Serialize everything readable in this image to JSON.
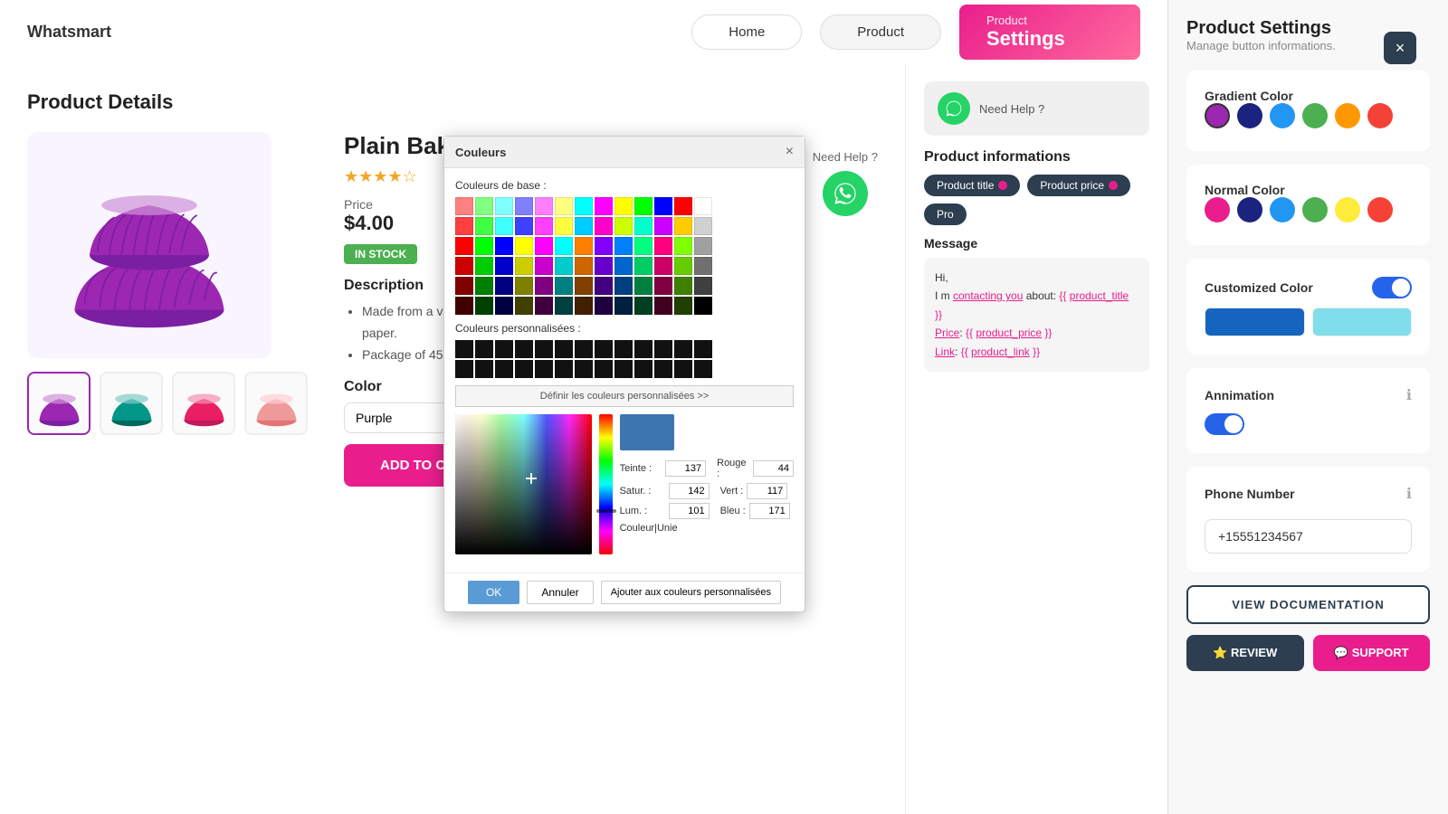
{
  "brand": "Whatsmart",
  "nav": {
    "home": "Home",
    "product": "Product",
    "settings_small": "Product",
    "settings_big": "Settings"
  },
  "product": {
    "section_title": "Product Details",
    "title": "Plain Baking Cups",
    "price_label": "Price",
    "price": "$4.00",
    "stock": "IN STOCK",
    "desc_title": "Description",
    "desc_items": [
      "Made from a very nice quality medium weight Swedish greaseproof paper.",
      "Package of 45 cups"
    ],
    "color_label": "Color",
    "color_value": "Purple",
    "add_to_cart": "ADD TO CART"
  },
  "need_help": {
    "text": "Need Help ?"
  },
  "whatsapp_panel": {
    "need_help": "Need Help ?",
    "product_informations": "Product informations",
    "tags": [
      "Product title",
      "Product price",
      "Pro"
    ],
    "message_label": "Message",
    "message": "Hi,\nI m contacting you about: {{ product_title }}\nPrice: {{ product_price }}\nLink: {{ product_link }}"
  },
  "settings": {
    "title": "Product Settings",
    "subtitle": "Manage button informations.",
    "close": "×",
    "gradient_color_label": "Gradient Color",
    "normal_color_label": "Normal Color",
    "customized_color_label": "Customized Color",
    "animation_label": "Annimation",
    "phone_label": "Phone Number",
    "phone_value": "+15551234567",
    "view_doc": "VIEW DOCUMENTATION",
    "review": "REVIEW",
    "support": "SUPPORT"
  },
  "colors": {
    "gradient": [
      "#9c27b0",
      "#1a237e",
      "#2196f3",
      "#4caf50",
      "#ff9800",
      "#f44336"
    ],
    "normal": [
      "#e91e8c",
      "#1a237e",
      "#2196f3",
      "#4caf50",
      "#ffeb3b",
      "#f44336"
    ],
    "custom1": "#1565c0",
    "custom2": "#80deea"
  },
  "dialog": {
    "title": "Couleurs",
    "close": "×",
    "base_label": "Couleurs de base :",
    "custom_label": "Couleurs personnalisées :",
    "define_btn": "Définir les couleurs personnalisées >>",
    "ok": "OK",
    "annuler": "Annuler",
    "ajouter": "Ajouter aux couleurs personnalisées",
    "teinte_label": "Teinte :",
    "teinte_val": "137",
    "rouge_label": "Rouge :",
    "rouge_val": "44",
    "satur_label": "Satur. :",
    "satur_val": "142",
    "vert_label": "Vert :",
    "vert_val": "117",
    "lum_label": "Lum. :",
    "lum_val": "101",
    "bleu_label": "Bleu :",
    "bleu_val": "171",
    "couleur_label": "Couleur|Unie"
  }
}
